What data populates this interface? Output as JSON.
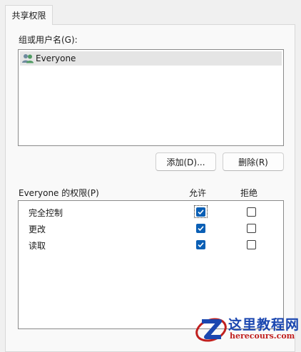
{
  "tab": {
    "label": "共享权限"
  },
  "group_section": {
    "label": "组或用户名(G):",
    "users": [
      {
        "name": "Everyone",
        "icon": "users-icon",
        "selected": true
      }
    ]
  },
  "buttons": {
    "add": "添加(D)...",
    "remove": "删除(R)"
  },
  "permissions": {
    "title": "Everyone 的权限(P)",
    "allow_header": "允许",
    "deny_header": "拒绝",
    "rows": [
      {
        "name": "完全控制",
        "allow": true,
        "deny": false
      },
      {
        "name": "更改",
        "allow": true,
        "deny": false
      },
      {
        "name": "读取",
        "allow": true,
        "deny": false
      }
    ]
  },
  "watermark": {
    "title": "这里教程网",
    "subtitle": "herecours.com"
  },
  "colors": {
    "accent": "#0a5fb5",
    "watermark_blue": "#1b47b0",
    "watermark_red": "#c0201f"
  }
}
